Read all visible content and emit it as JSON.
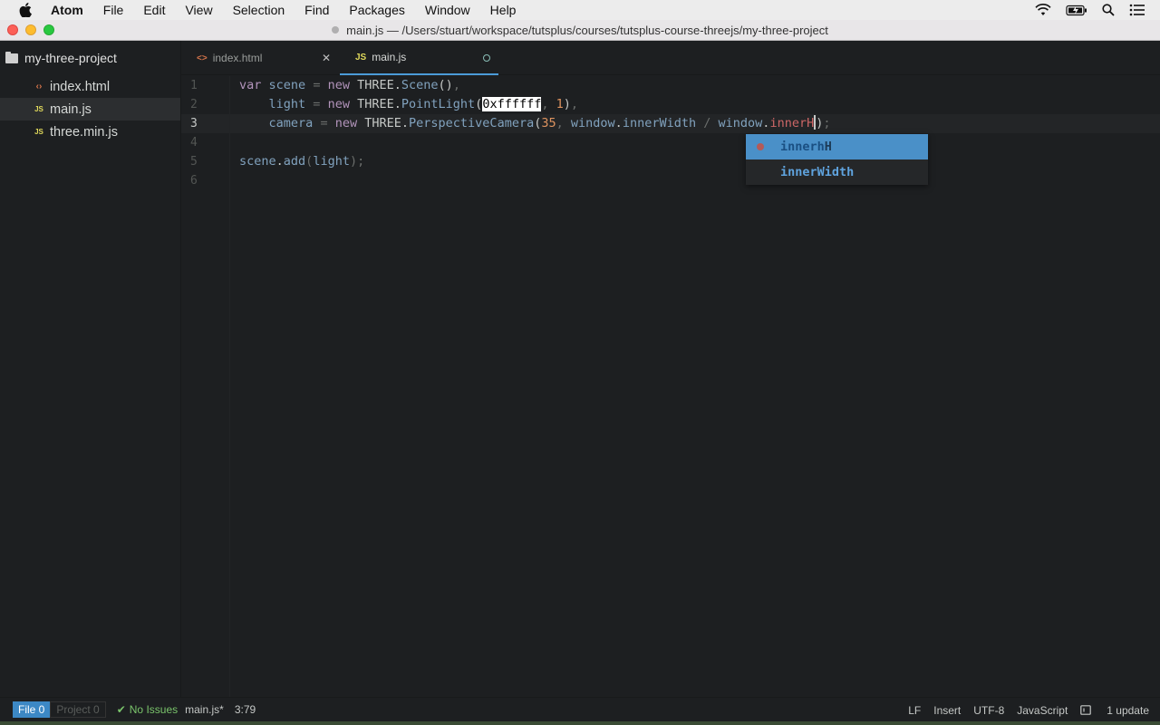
{
  "menubar": {
    "app": "Atom",
    "items": [
      "File",
      "Edit",
      "View",
      "Selection",
      "Find",
      "Packages",
      "Window",
      "Help"
    ]
  },
  "titlebar": {
    "title": "main.js — /Users/stuart/workspace/tutsplus/courses/tutsplus-course-threejs/my-three-project"
  },
  "treeview": {
    "root": "my-three-project",
    "files": [
      {
        "name": "index.html",
        "icon": "html-icon"
      },
      {
        "name": "main.js",
        "icon": "js-icon",
        "selected": true
      },
      {
        "name": "three.min.js",
        "icon": "js-icon"
      }
    ]
  },
  "tabs": [
    {
      "label": "index.html",
      "icon": "<>",
      "active": false
    },
    {
      "label": "main.js",
      "icon": "JS",
      "active": true,
      "modified": true
    }
  ],
  "editor": {
    "line_numbers": [
      "1",
      "2",
      "3",
      "4",
      "5",
      "6"
    ],
    "current_line": 3
  },
  "autocomplete": {
    "items": [
      {
        "match": "innerh",
        "rest": "H",
        "selected": true
      },
      {
        "match": "inner",
        "rest": "Width",
        "selected": false
      }
    ]
  },
  "statusbar": {
    "file_label": "File 0",
    "project_label": "Project 0",
    "issues": "No Issues",
    "filename": "main.js*",
    "cursor": "3:79",
    "line_ending": "LF",
    "mode": "Insert",
    "encoding": "UTF-8",
    "grammar": "JavaScript",
    "updates": "1 update"
  },
  "colors": {
    "background": "#1d1f21",
    "accent": "#4b9bd8",
    "autocomplete_selected": "#4a90c8"
  }
}
